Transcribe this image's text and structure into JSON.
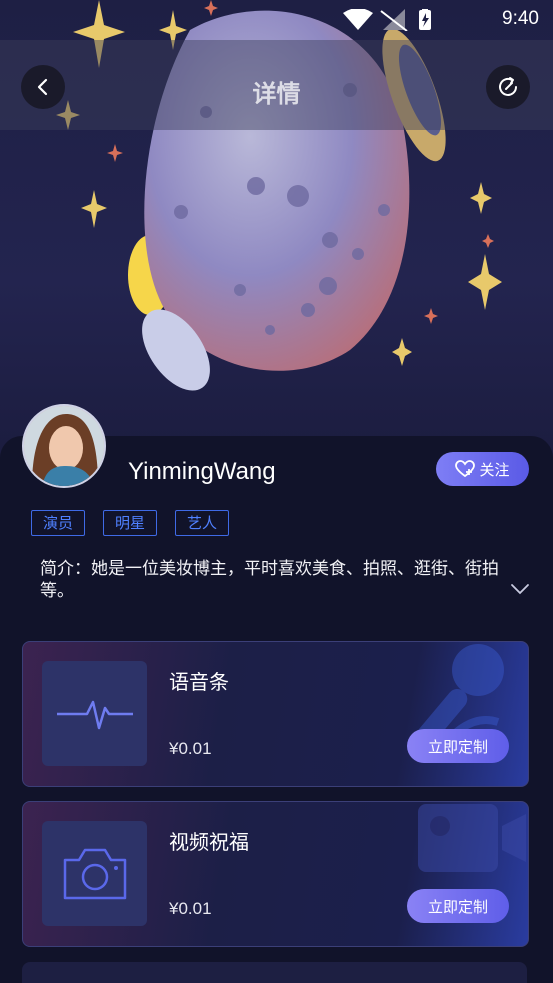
{
  "status_bar": {
    "time": "9:40"
  },
  "nav": {
    "title": "详情"
  },
  "profile": {
    "name": "YinmingWang",
    "follow_label": "关注",
    "tags": [
      "演员",
      "明星",
      "艺人"
    ],
    "intro": "简介：她是一位美妆博主，平时喜欢美食、拍照、逛街、街拍等。"
  },
  "products": [
    {
      "title": "语音条",
      "price": "¥0.01",
      "button": "立即定制",
      "icon": "waveform-icon"
    },
    {
      "title": "视频祝福",
      "price": "¥0.01",
      "button": "立即定制",
      "icon": "camera-icon"
    }
  ],
  "colors": {
    "accent": "#6f6cf0",
    "tag_blue": "#4f80ff",
    "background": "#11132a"
  }
}
